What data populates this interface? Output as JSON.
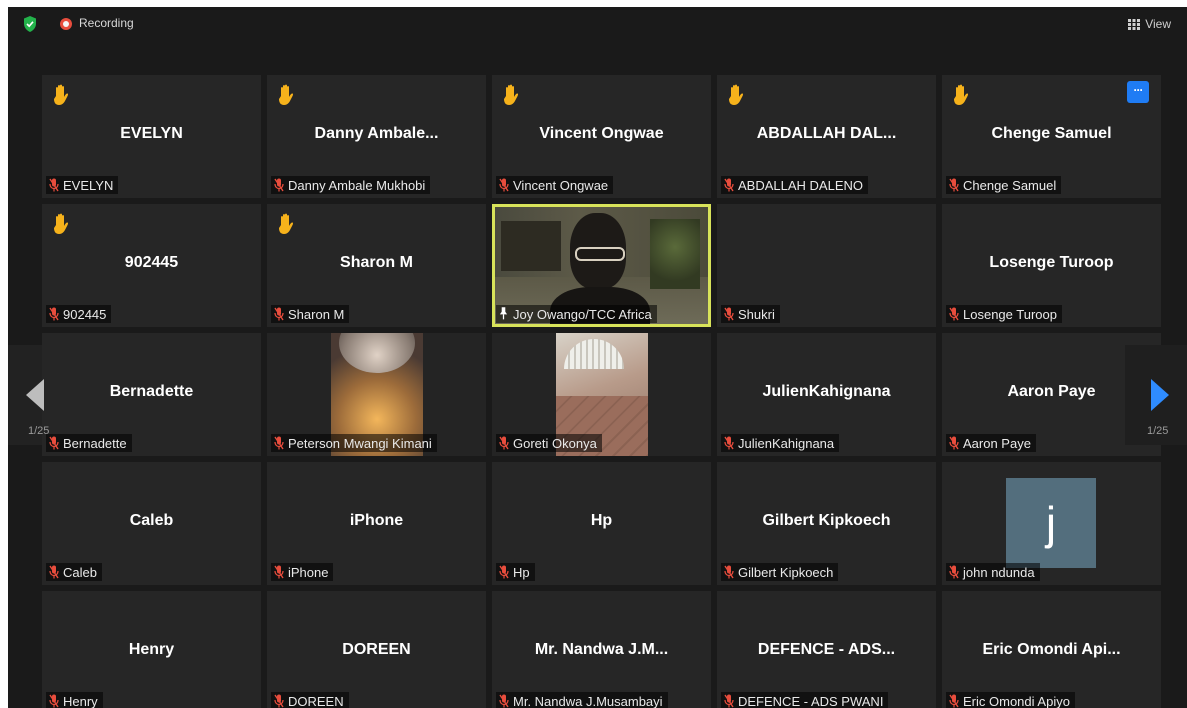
{
  "topbar": {
    "recording_label": "Recording",
    "view_label": "View"
  },
  "colors": {
    "background": "#1a1a1a",
    "tile": "#262626",
    "active_speaker_border": "#d8e35a",
    "hand": "#f6b21b",
    "muted_mic": "#e84d3d",
    "more_button": "#1f7cf4",
    "nav_arrow": "#2f8cff"
  },
  "pagination": {
    "left_page": "1/25",
    "right_page": "1/25"
  },
  "participants": [
    {
      "display": "EVELYN",
      "label": "EVELYN",
      "hand": true
    },
    {
      "display": "Danny Ambale...",
      "label": "Danny Ambale Mukhobi",
      "hand": true
    },
    {
      "display": "Vincent Ongwae",
      "label": "Vincent Ongwae",
      "hand": true
    },
    {
      "display": "ABDALLAH DAL...",
      "label": "ABDALLAH DALENO",
      "hand": true
    },
    {
      "display": "Chenge Samuel",
      "label": "Chenge Samuel",
      "hand": true,
      "more": true
    },
    {
      "display": "902445",
      "label": "902445",
      "hand": true
    },
    {
      "display": "Sharon M",
      "label": "Sharon M",
      "hand": true
    },
    {
      "display": "",
      "label": "Joy Owango/TCC Africa",
      "video": "joy",
      "pinned": true,
      "active": true
    },
    {
      "display": "",
      "label": "Shukri"
    },
    {
      "display": "Losenge Turoop",
      "label": "Losenge Turoop"
    },
    {
      "display": "Bernadette",
      "label": "Bernadette"
    },
    {
      "display": "",
      "label": "Peterson Mwangi Kimani",
      "video": "pm"
    },
    {
      "display": "",
      "label": "Goreti Okonya",
      "video": "go"
    },
    {
      "display": "JulienKahignana",
      "label": "JulienKahignana"
    },
    {
      "display": "Aaron Paye",
      "label": "Aaron Paye"
    },
    {
      "display": "Caleb",
      "label": "Caleb"
    },
    {
      "display": "iPhone",
      "label": "iPhone"
    },
    {
      "display": "Hp",
      "label": "Hp"
    },
    {
      "display": "Gilbert Kipkoech",
      "label": "Gilbert Kipkoech"
    },
    {
      "display": "",
      "label": "john ndunda",
      "avatar": "j"
    },
    {
      "display": "Henry",
      "label": "Henry"
    },
    {
      "display": "DOREEN",
      "label": "DOREEN"
    },
    {
      "display": "Mr. Nandwa J.M...",
      "label": "Mr. Nandwa J.Musambayi"
    },
    {
      "display": "DEFENCE - ADS...",
      "label": "DEFENCE - ADS PWANI"
    },
    {
      "display": "Eric Omondi Api...",
      "label": "Eric Omondi Apiyo"
    }
  ]
}
